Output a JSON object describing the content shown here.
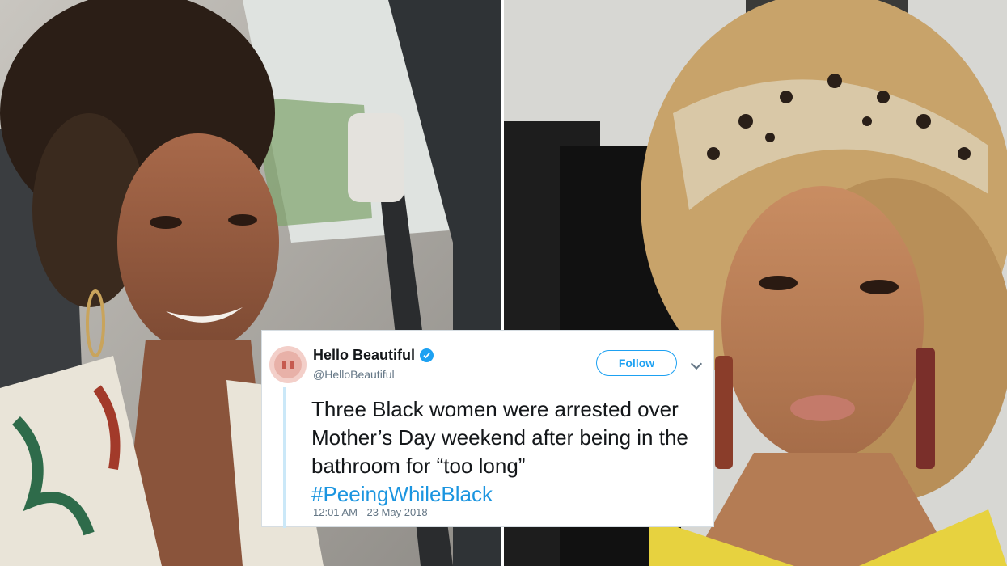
{
  "tweet": {
    "display_name": "Hello Beautiful",
    "handle": "@HelloBeautiful",
    "follow_label": "Follow",
    "text": "Three Black women were arrested over Mother’s Day weekend after being in the bathroom for “too long”",
    "hashtag": "#PeeingWhileBlack",
    "timestamp": "12:01 AM - 23 May 2018"
  },
  "icons": {
    "avatar": "hello-beautiful-avatar-icon",
    "verified": "verified-badge-icon",
    "menu": "chevron-down-icon"
  },
  "colors": {
    "accent": "#1da1f2",
    "hashtag": "#1b95e0",
    "secondary_text": "#657786",
    "thread_line": "#cbe8f8"
  }
}
